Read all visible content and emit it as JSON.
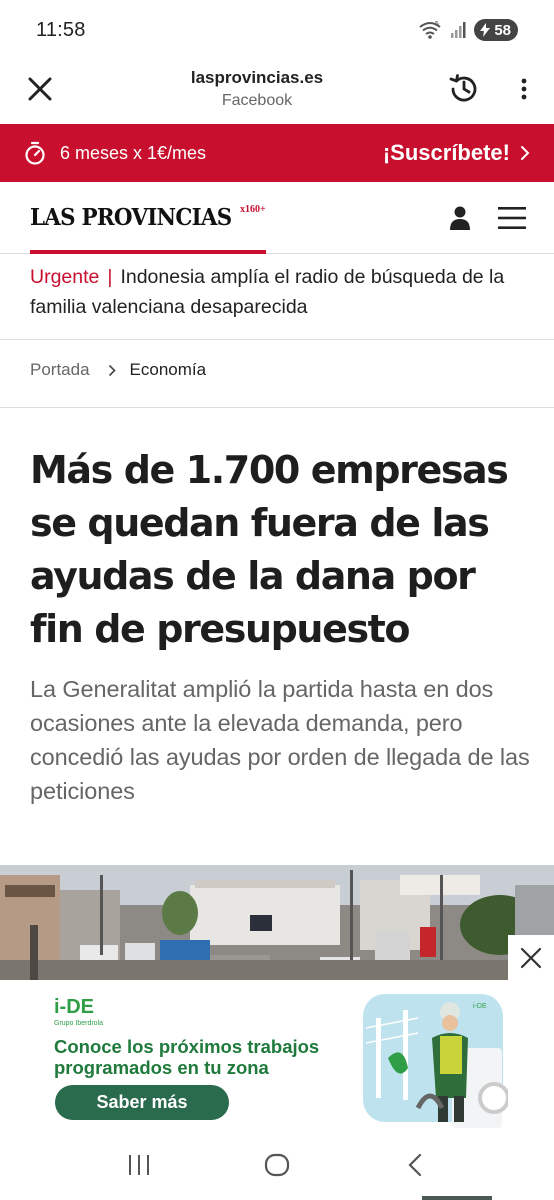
{
  "status_bar": {
    "time": "11:58",
    "battery": "58",
    "icons": [
      "wifi-icon",
      "signal-icon",
      "battery-icon"
    ]
  },
  "browser": {
    "domain": "lasprovincias.es",
    "source": "Facebook",
    "icons": [
      "close-icon",
      "history-icon",
      "more-vert-icon"
    ]
  },
  "promo": {
    "offer": "6 meses x 1€/mes",
    "cta": "¡Suscríbete!",
    "background": "#c8102e"
  },
  "site": {
    "logo": "LAS PROVINCIAS",
    "logo_badge": "x160+",
    "accent": "#c8102e",
    "icons": [
      "user-icon",
      "hamburger-menu-icon"
    ]
  },
  "urgent": {
    "label": "Urgente",
    "separator": "|",
    "text": "Indonesia amplía el radio de búsqueda de la familia valenciana desaparecida"
  },
  "breadcrumb": {
    "home": "Portada",
    "current": "Economía"
  },
  "article": {
    "headline": "Más de 1.700 empresas se quedan fuera de las ayudas de la dana por fin de presupuesto",
    "subtitle": "La Generalitat amplió la partida hasta en dos ocasiones ante la elevada demanda, pero concedió las ayudas por orden de llegada de las peticiones"
  },
  "ad": {
    "brand": "i-DE",
    "brand_sub": "Grupo Iberdrola",
    "text": "Conoce los próximos trabajos programados en tu zona",
    "button": "Saber más",
    "brand_color": "#2f9e46"
  },
  "nav": {
    "icons": [
      "recent-apps-icon",
      "home-icon",
      "back-icon"
    ]
  }
}
